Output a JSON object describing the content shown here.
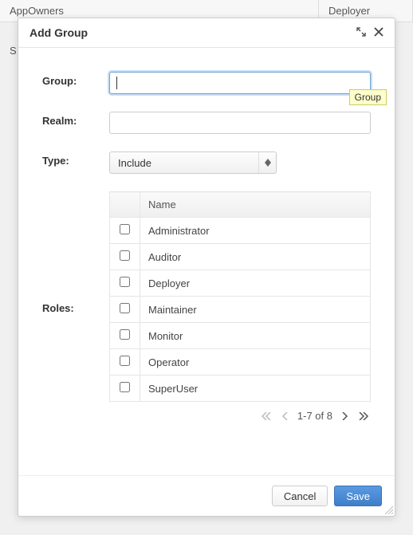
{
  "background": {
    "col1": "AppOwners",
    "col2": "Deployer",
    "row2": "S"
  },
  "modal": {
    "title": "Add Group",
    "tooltip": "Group",
    "labels": {
      "group": "Group:",
      "realm": "Realm:",
      "type": "Type:",
      "roles": "Roles:"
    },
    "fields": {
      "group_value": "",
      "realm_value": "",
      "type_value": "Include"
    },
    "roles_table": {
      "header": "Name",
      "rows": [
        {
          "name": "Administrator",
          "checked": false
        },
        {
          "name": "Auditor",
          "checked": false
        },
        {
          "name": "Deployer",
          "checked": false
        },
        {
          "name": "Maintainer",
          "checked": false
        },
        {
          "name": "Monitor",
          "checked": false
        },
        {
          "name": "Operator",
          "checked": false
        },
        {
          "name": "SuperUser",
          "checked": false
        }
      ]
    },
    "pager": {
      "text": "1-7 of 8"
    },
    "buttons": {
      "cancel": "Cancel",
      "save": "Save"
    }
  }
}
